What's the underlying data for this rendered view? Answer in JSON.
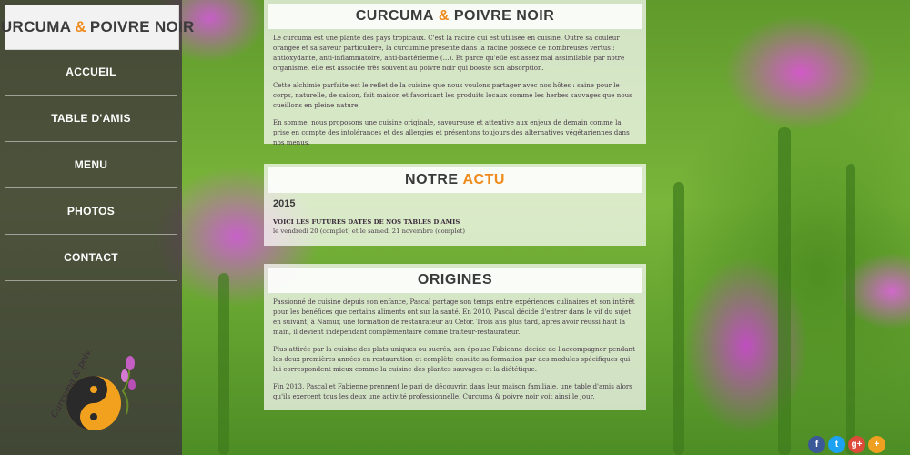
{
  "brand": {
    "part1": "CURCUMA",
    "amp": "&",
    "part2": "POIVRE NOIR"
  },
  "nav": [
    {
      "label": "ACCUEIL"
    },
    {
      "label": "TABLE D'AMIS"
    },
    {
      "label": "MENU"
    },
    {
      "label": "PHOTOS"
    },
    {
      "label": "CONTACT"
    }
  ],
  "logo": {
    "text": "Curcuma & poivre noir"
  },
  "intro": {
    "title_part1": "CURCUMA",
    "title_amp": "&",
    "title_part2": "POIVRE NOIR",
    "paragraphs": [
      "Le curcuma est une plante des pays tropicaux. C'est la racine qui est utilisée en cuisine. Outre sa couleur orangée et sa saveur particulière, la curcumine présente dans la racine possède de nombreuses vertus : antioxydante, anti-inflammatoire, anti-bactérienne (...). Et parce qu'elle est assez mal assimilable par notre organisme, elle est associée très souvent au poivre noir qui booste son absorption.",
      "Cette alchimie parfaite est le reflet de la cuisine que nous voulons partager avec nos hôtes : saine pour le corps, naturelle, de saison, fait maison et favorisant les produits locaux comme les herbes sauvages que nous cueillons en pleine nature.",
      "En somme, nous proposons une cuisine originale, savoureuse et attentive aux enjeux de demain comme la prise en compte des intolérances et des allergies et présentons toujours des alternatives végétariennes dans nos menus."
    ]
  },
  "actu": {
    "title_part1": "NOTRE",
    "title_part2": "ACTU",
    "year": "2015",
    "news_title": "VOICI LES FUTURES DATES DE NOS TABLES D'AMIS",
    "news_body": "le vendredi 20 (complet) et le samedi 21 novembre (complet)"
  },
  "origines": {
    "title": "ORIGINES",
    "paragraphs": [
      "Passionné de cuisine depuis son enfance, Pascal partage son temps entre expériences culinaires et son intérêt pour les bénéfices que certains aliments ont sur la santé. En 2010, Pascal décide d'entrer dans le vif du sujet en suivant, à Namur, une formation de restaurateur au Cefor. Trois ans plus tard, après avoir réussi haut la main, il devient indépendant complémentaire comme traiteur-restaurateur.",
      "Plus attirée par la cuisine des plats uniques ou sucrés, son épouse Fabienne décide de l'accompagner pendant les deux premières années en restauration et complète ensuite sa formation par des modules spécifiques qui lui correspondent mieux comme la cuisine des plantes sauvages et la diététique.",
      "Fin 2013, Pascal et Fabienne prennent le pari de découvrir, dans leur maison familiale, une table d'amis alors qu'ils exercent tous les deux une activité professionnelle. Curcuma & poivre noir voit ainsi le jour."
    ]
  },
  "social": [
    {
      "icon": "facebook-icon",
      "glyph": "f",
      "color": "#3b5998"
    },
    {
      "icon": "twitter-icon",
      "glyph": "t",
      "color": "#1da1f2"
    },
    {
      "icon": "google-plus-icon",
      "glyph": "g+",
      "color": "#dd4b39"
    },
    {
      "icon": "plus-icon",
      "glyph": "+",
      "color": "#f0a020"
    }
  ]
}
